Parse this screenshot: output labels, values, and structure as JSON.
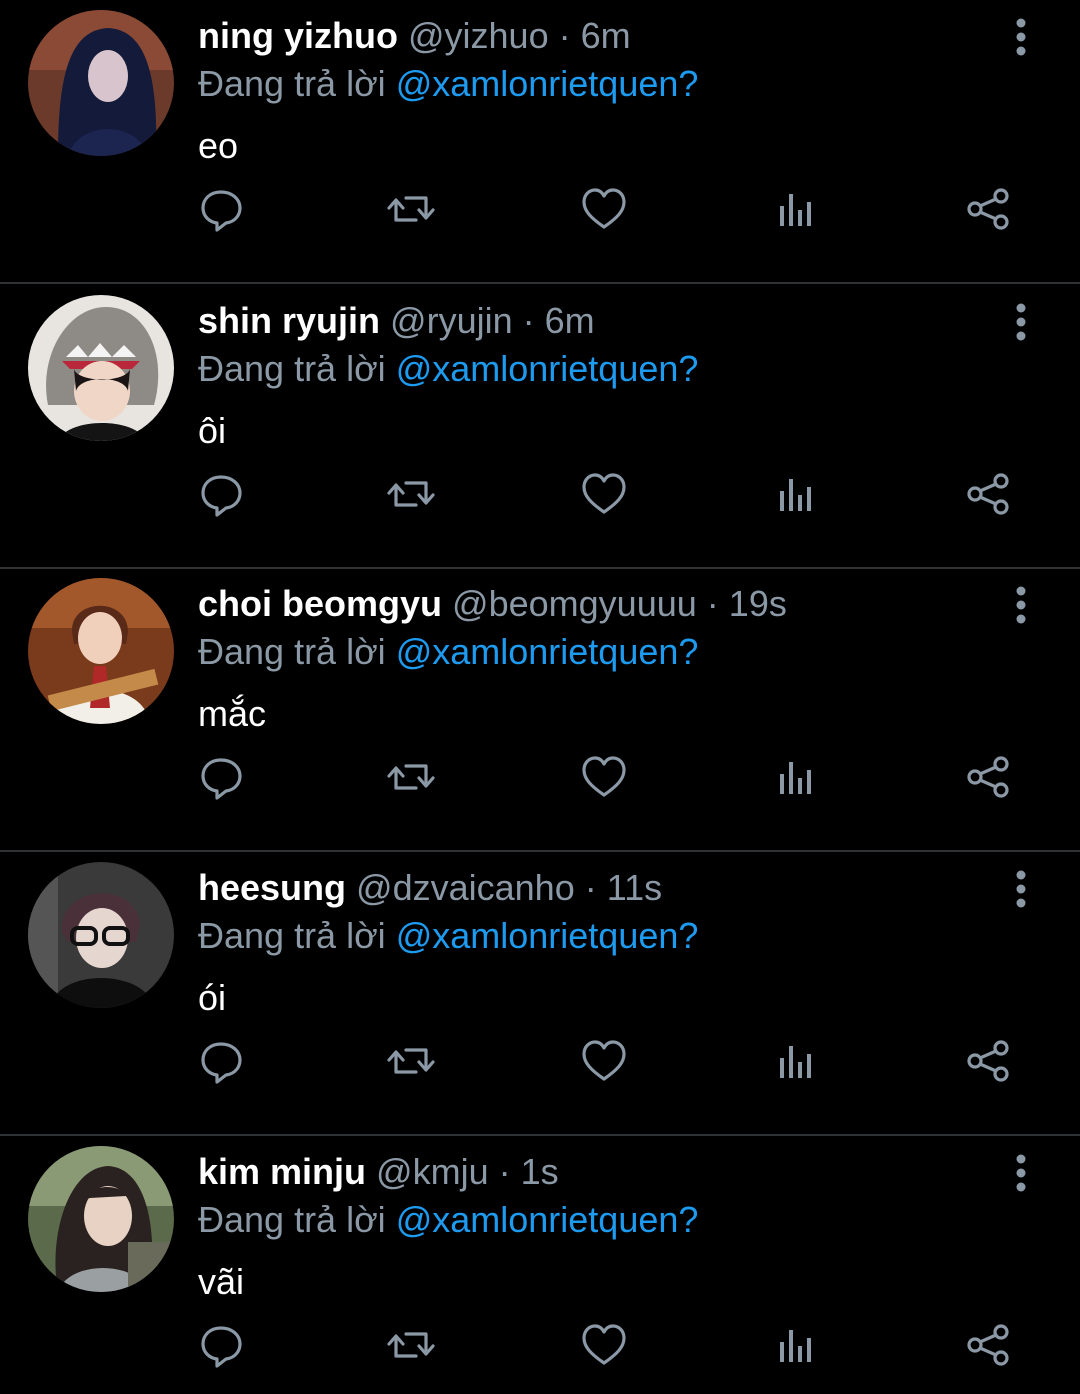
{
  "colors": {
    "background": "#000000",
    "name": "#ffffff",
    "muted": "#8b98a5",
    "mention": "#1d9bf0",
    "divider": "#2f3336"
  },
  "tweets": [
    {
      "name": "ning yizhuo",
      "handle": "@yizhuo",
      "separator": "·",
      "time": "6m",
      "reply_prefix": "Đang trả lời",
      "reply_to": "@xamlonrietquen?",
      "text": "eo",
      "avatar_icon": "avatar-photo"
    },
    {
      "name": "shin ryujin",
      "handle": "@ryujin",
      "separator": "·",
      "time": "6m",
      "reply_prefix": "Đang trả lời",
      "reply_to": "@xamlonrietquen?",
      "text": "ôi",
      "avatar_icon": "avatar-photo"
    },
    {
      "name": "choi beomgyu",
      "handle": "@beomgyuuuu",
      "separator": "·",
      "time": "19s",
      "reply_prefix": "Đang trả lời",
      "reply_to": "@xamlonrietquen?",
      "text": "mắc",
      "avatar_icon": "avatar-photo"
    },
    {
      "name": "heesung",
      "handle": "@dzvaicanho",
      "separator": "·",
      "time": "11s",
      "reply_prefix": "Đang trả lời",
      "reply_to": "@xamlonrietquen?",
      "text": "ói",
      "avatar_icon": "avatar-photo"
    },
    {
      "name": "kim minju",
      "handle": "@kmju",
      "separator": "·",
      "time": "1s",
      "reply_prefix": "Đang trả lời",
      "reply_to": "@xamlonrietquen?",
      "text": "vãi",
      "avatar_icon": "avatar-photo"
    }
  ],
  "actions": [
    "reply-icon",
    "retweet-icon",
    "like-icon",
    "views-icon",
    "share-icon"
  ]
}
